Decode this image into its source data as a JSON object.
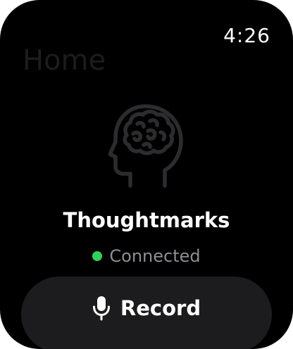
{
  "status_bar": {
    "time": "4:26"
  },
  "header": {
    "title": "Home"
  },
  "app": {
    "name": "Thoughtmarks",
    "logo_icon": "head-brain-icon"
  },
  "connection": {
    "status_label": "Connected",
    "status_color": "#30d158"
  },
  "actions": {
    "record_label": "Record",
    "record_icon": "microphone-icon"
  },
  "colors": {
    "background": "#000000",
    "button_background": "#1c1c1e",
    "title_color": "#1c1c1e",
    "secondary_text": "#8e8e93"
  }
}
